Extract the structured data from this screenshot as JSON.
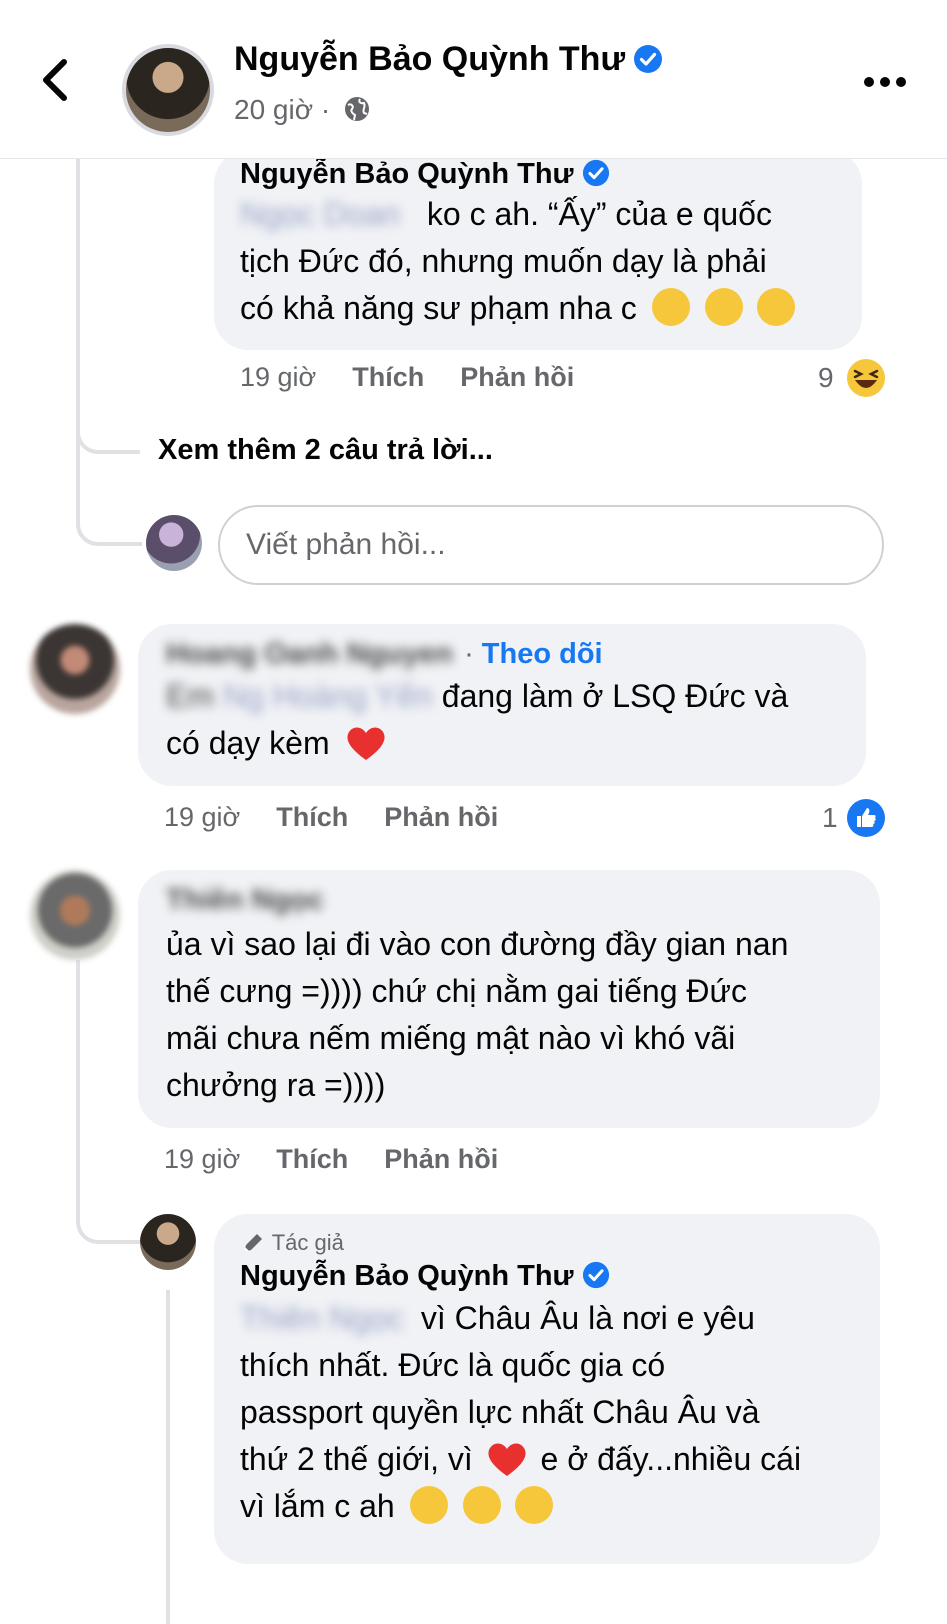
{
  "header": {
    "title": "Nguyễn Bảo Quỳnh Thư",
    "time": "20 giờ",
    "separator": "·"
  },
  "reply1": {
    "author": "Nguyễn Bảo Quỳnh Thư",
    "mention": "Ngọc Doan",
    "text_line1": "ko c ah. “Ấy” của e quốc",
    "text_line2": "tịch Đức đó, nhưng muốn dạy là phải",
    "text_line3": "có khả năng sư phạm nha c",
    "emojis": [
      "😅",
      "😂",
      "🤣"
    ],
    "time": "19 giờ",
    "like": "Thích",
    "reply": "Phản hồi",
    "reaction_count": "9",
    "reaction_icon": "haha-icon"
  },
  "see_more": "Xem thêm 2 câu trả lời...",
  "reply_input": {
    "placeholder": "Viết phản hồi..."
  },
  "comment2": {
    "author": "Hoang Oanh Nguyen",
    "follow": "Theo dõi",
    "prefix": "Em",
    "mention": "Ng Hoàng Yến",
    "text_line1": "đang làm ở LSQ Đức và",
    "text_line2": "có dạy kèm",
    "emoji": "❤️",
    "time": "19 giờ",
    "like": "Thích",
    "reply": "Phản hồi",
    "reaction_count": "1",
    "reaction_icon": "like-icon"
  },
  "comment3": {
    "author": "Thiên Ngọc",
    "text_line1": "ủa vì sao lại đi vào con đường đầy gian nan",
    "text_line2": "thế cưng =)))) chứ chị nằm gai tiếng Đức",
    "text_line3": "mãi chưa nếm miếng mật nào vì khó vãi",
    "text_line4": "chưởng ra =))))",
    "time": "19 giờ",
    "like": "Thích",
    "reply": "Phản hồi"
  },
  "reply2": {
    "badge": "Tác giả",
    "author": "Nguyễn Bảo Quỳnh Thư",
    "mention": "Thiên Ngọc",
    "text_line1": "vì Châu Âu là nơi e yêu",
    "text_line2": "thích nhất. Đức là quốc gia có",
    "text_line3": "passport quyền lực nhất Châu Âu và",
    "text_line4a": "thứ 2 thế giới, vì",
    "text_line4b": "e ở đấy...nhiều cái",
    "text_line5": "vì lắm c ah",
    "emojis": [
      "😆",
      "😆",
      "😆"
    ]
  },
  "colors": {
    "accent": "#1877f2",
    "bubble": "#f0f2f5",
    "meta": "#65676b",
    "heart": "#e8312f"
  }
}
